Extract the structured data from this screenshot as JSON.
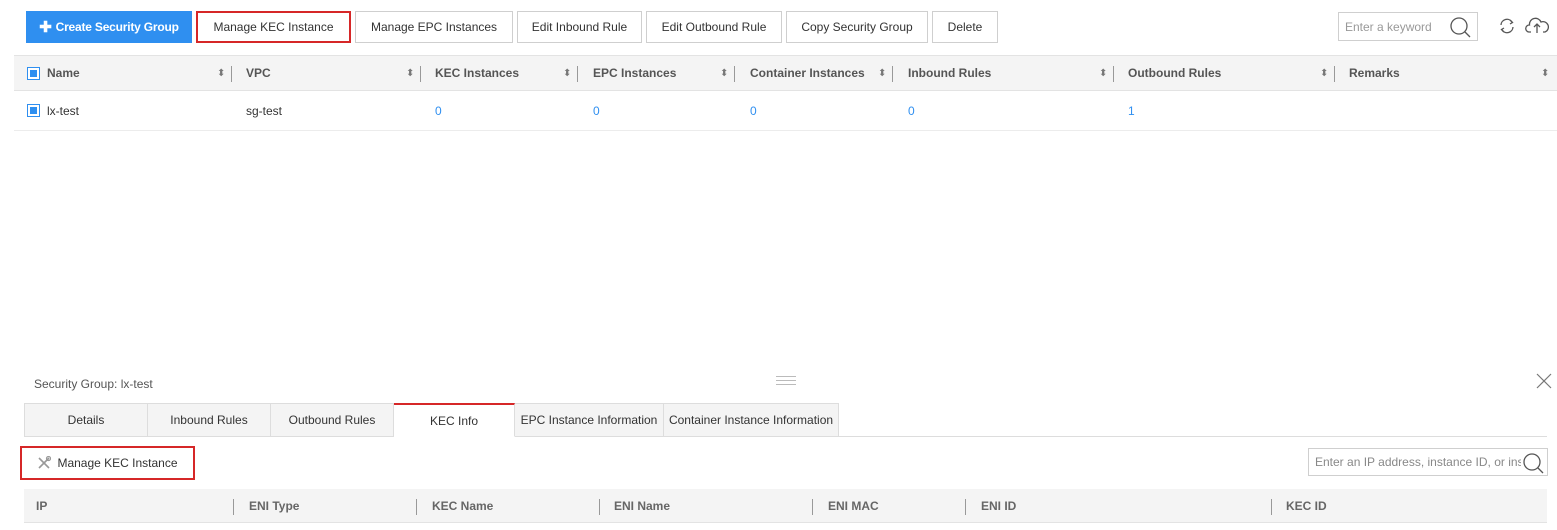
{
  "toolbar": {
    "create": "Create Security Group",
    "manage_kec": "Manage KEC Instance",
    "manage_epc": "Manage EPC Instances",
    "edit_inbound": "Edit Inbound Rule",
    "edit_outbound": "Edit Outbound Rule",
    "copy": "Copy Security Group",
    "delete": "Delete",
    "search_placeholder": "Enter a keyword"
  },
  "table": {
    "columns": [
      "Name",
      "VPC",
      "KEC Instances",
      "EPC Instances",
      "Container Instances",
      "Inbound Rules",
      "Outbound Rules",
      "Remarks"
    ],
    "rows": [
      {
        "name": "lx-test",
        "vpc": "sg-test",
        "kec": "0",
        "epc": "0",
        "container": "0",
        "inbound": "0",
        "outbound": "1",
        "remarks": ""
      }
    ]
  },
  "panel": {
    "title": "Security Group: lx-test",
    "tabs": [
      "Details",
      "Inbound Rules",
      "Outbound Rules",
      "KEC Info",
      "EPC Instance Information",
      "Container Instance Information"
    ],
    "active_tab": "KEC Info",
    "manage_button": "Manage KEC Instance",
    "search_placeholder": "Enter an IP address, instance ID, or instance",
    "columns": [
      "IP",
      "ENI Type",
      "KEC Name",
      "ENI Name",
      "ENI MAC",
      "ENI ID",
      "KEC ID"
    ]
  },
  "colors": {
    "primary": "#2f8ff0",
    "highlight": "#d62728"
  }
}
